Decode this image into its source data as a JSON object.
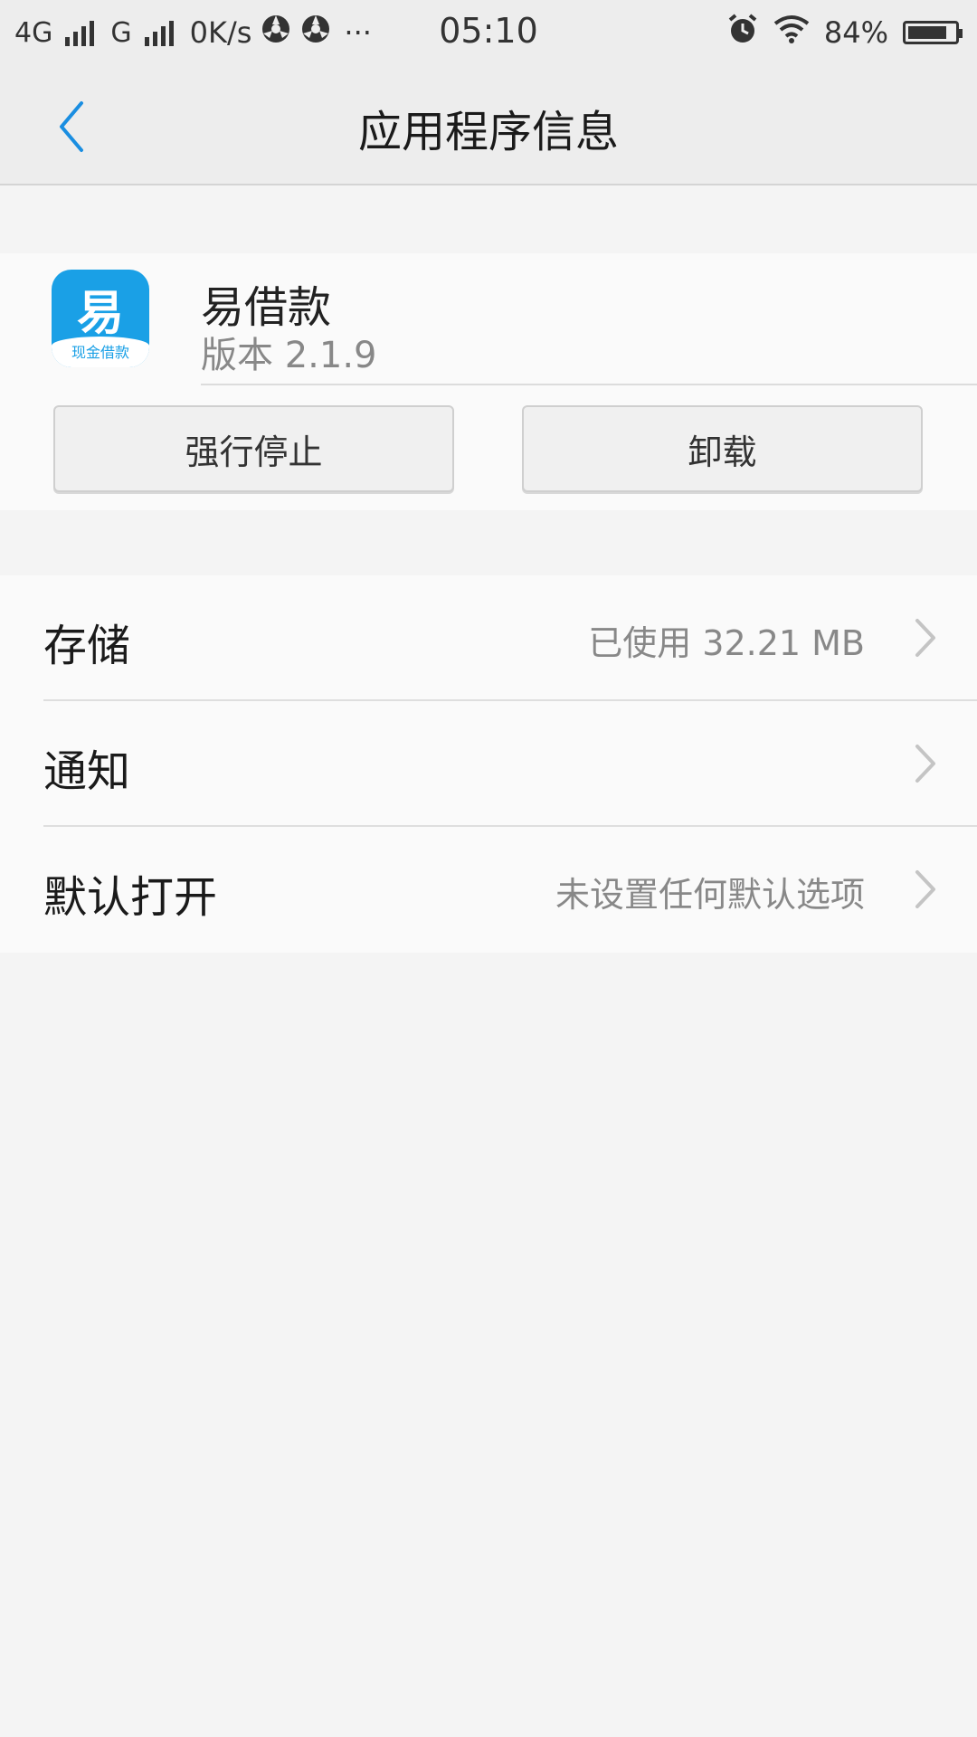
{
  "status_bar": {
    "network_1": "4G",
    "network_2": "G",
    "speed": "0K/s",
    "more": "···",
    "time": "05:10",
    "battery_text": "84%",
    "battery_level": 0.84
  },
  "app_bar": {
    "back_icon": "chevron-left-icon",
    "title": "应用程序信息"
  },
  "app_info": {
    "icon_glyph": "易",
    "icon_caption": "现金借款",
    "name": "易借款",
    "version": "版本 2.1.9",
    "force_stop_label": "强行停止",
    "uninstall_label": "卸载"
  },
  "settings": [
    {
      "label": "存储",
      "value": "已使用 32.21 MB"
    },
    {
      "label": "通知",
      "value": ""
    },
    {
      "label": "默认打开",
      "value": "未设置任何默认选项"
    }
  ],
  "colors": {
    "accent": "#1a8ee1",
    "app_icon": "#1aa0e6",
    "background": "#f4f4f4"
  }
}
